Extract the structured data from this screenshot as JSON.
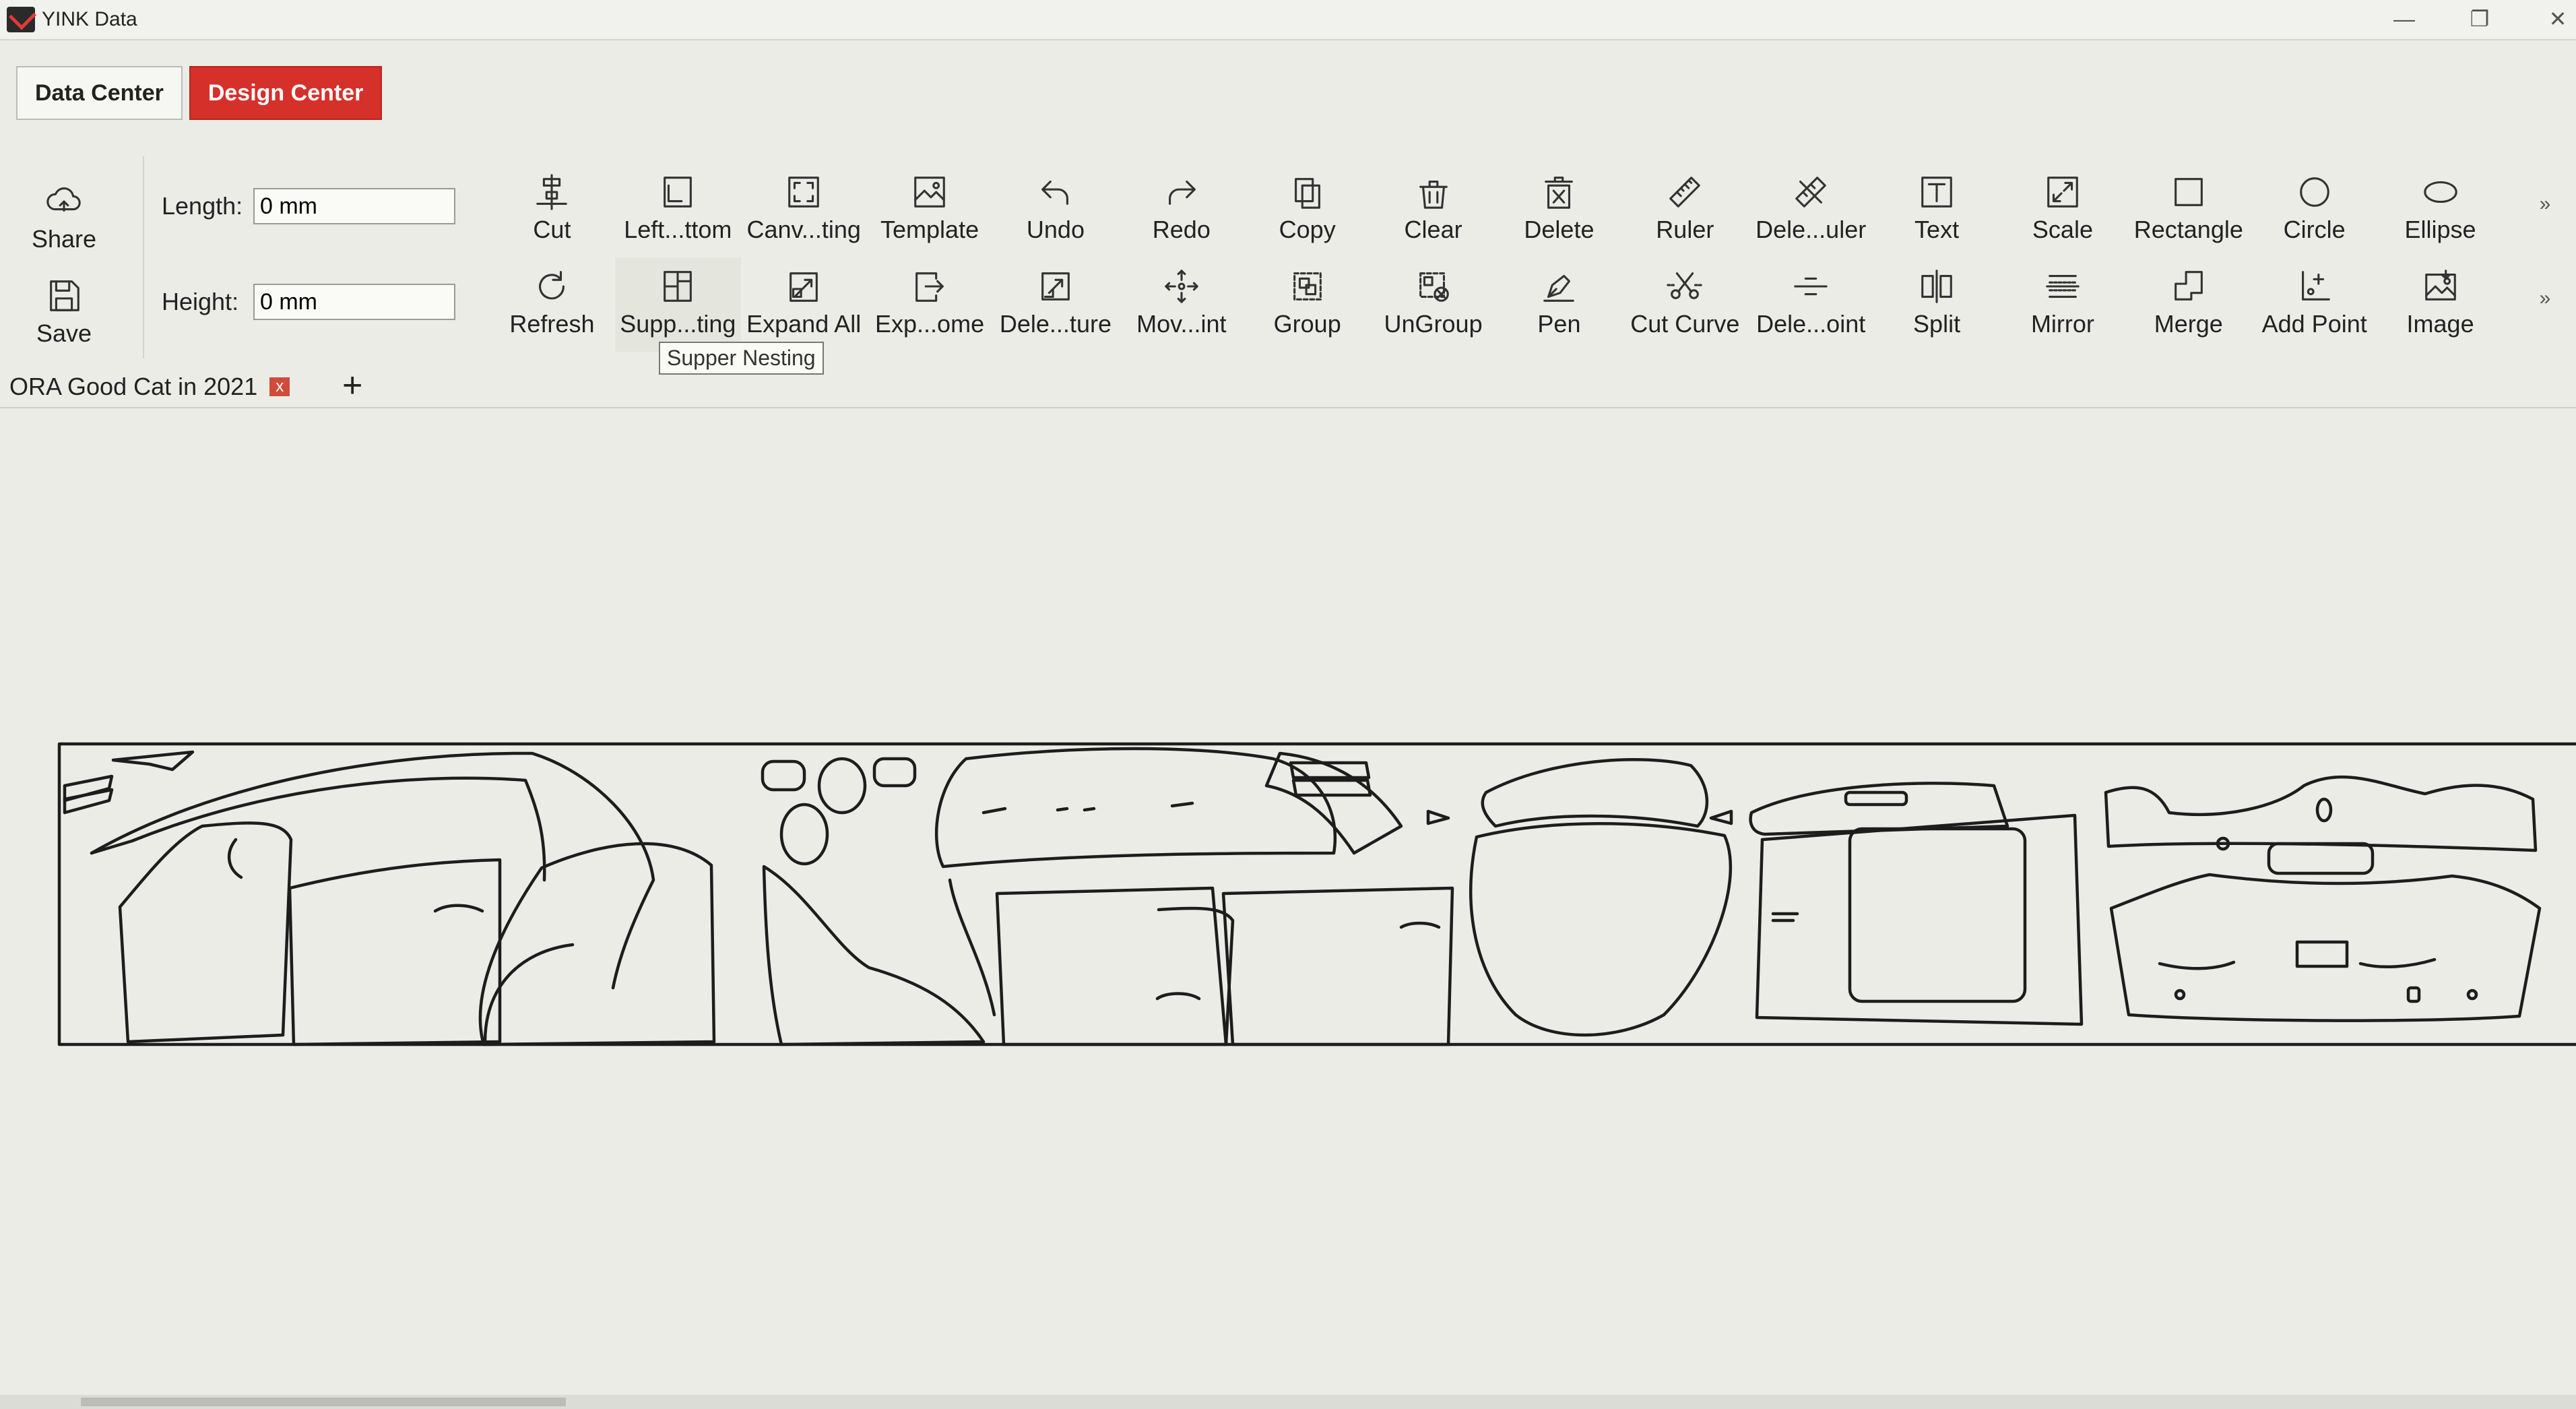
{
  "app": {
    "title": "YINK Data"
  },
  "center_tabs": [
    {
      "label": "Data Center",
      "active": false
    },
    {
      "label": "Design Center",
      "active": true
    }
  ],
  "left_actions": [
    {
      "label": "Share",
      "icon": "cloud-share-icon"
    },
    {
      "label": "Save",
      "icon": "save-icon"
    }
  ],
  "dimensions": {
    "length_label": "Length:",
    "length_value": "0 mm",
    "height_label": "Height:",
    "height_value": "0 mm"
  },
  "toolbar_row1": [
    {
      "label": "Cut",
      "icon": "cut-icon"
    },
    {
      "label": "Left...ttom",
      "icon": "align-left-bottom-icon"
    },
    {
      "label": "Canv...ting",
      "icon": "canvas-setting-icon"
    },
    {
      "label": "Template",
      "icon": "template-icon"
    },
    {
      "label": "Undo",
      "icon": "undo-icon"
    },
    {
      "label": "Redo",
      "icon": "redo-icon"
    },
    {
      "label": "Copy",
      "icon": "copy-icon"
    },
    {
      "label": "Clear",
      "icon": "clear-icon"
    },
    {
      "label": "Delete",
      "icon": "delete-icon"
    },
    {
      "label": "Ruler",
      "icon": "ruler-icon"
    },
    {
      "label": "Dele...uler",
      "icon": "delete-ruler-icon"
    },
    {
      "label": "Text",
      "icon": "text-icon"
    },
    {
      "label": "Scale",
      "icon": "scale-icon"
    },
    {
      "label": "Rectangle",
      "icon": "rectangle-icon"
    },
    {
      "label": "Circle",
      "icon": "circle-icon"
    },
    {
      "label": "Ellipse",
      "icon": "ellipse-icon"
    }
  ],
  "toolbar_row2": [
    {
      "label": "Refresh",
      "icon": "refresh-icon"
    },
    {
      "label": "Supp...ting",
      "icon": "supper-nesting-icon"
    },
    {
      "label": "Expand All",
      "icon": "expand-all-icon"
    },
    {
      "label": "Exp...ome",
      "icon": "export-icon"
    },
    {
      "label": "Dele...ture",
      "icon": "delete-texture-icon"
    },
    {
      "label": "Mov...int",
      "icon": "move-point-icon"
    },
    {
      "label": "Group",
      "icon": "group-icon"
    },
    {
      "label": "UnGroup",
      "icon": "ungroup-icon"
    },
    {
      "label": "Pen",
      "icon": "pen-icon"
    },
    {
      "label": "Cut Curve",
      "icon": "cut-curve-icon"
    },
    {
      "label": "Dele...oint",
      "icon": "delete-point-icon"
    },
    {
      "label": "Split",
      "icon": "split-icon"
    },
    {
      "label": "Mirror",
      "icon": "mirror-icon"
    },
    {
      "label": "Merge",
      "icon": "merge-icon"
    },
    {
      "label": "Add Point",
      "icon": "add-point-icon"
    },
    {
      "label": "Image",
      "icon": "image-icon"
    }
  ],
  "more_glyph": "»",
  "tooltip": "Supper Nesting",
  "document_tabs": [
    {
      "label": "ORA Good Cat in 2021",
      "close": "x"
    }
  ],
  "add_tab_glyph": "+"
}
